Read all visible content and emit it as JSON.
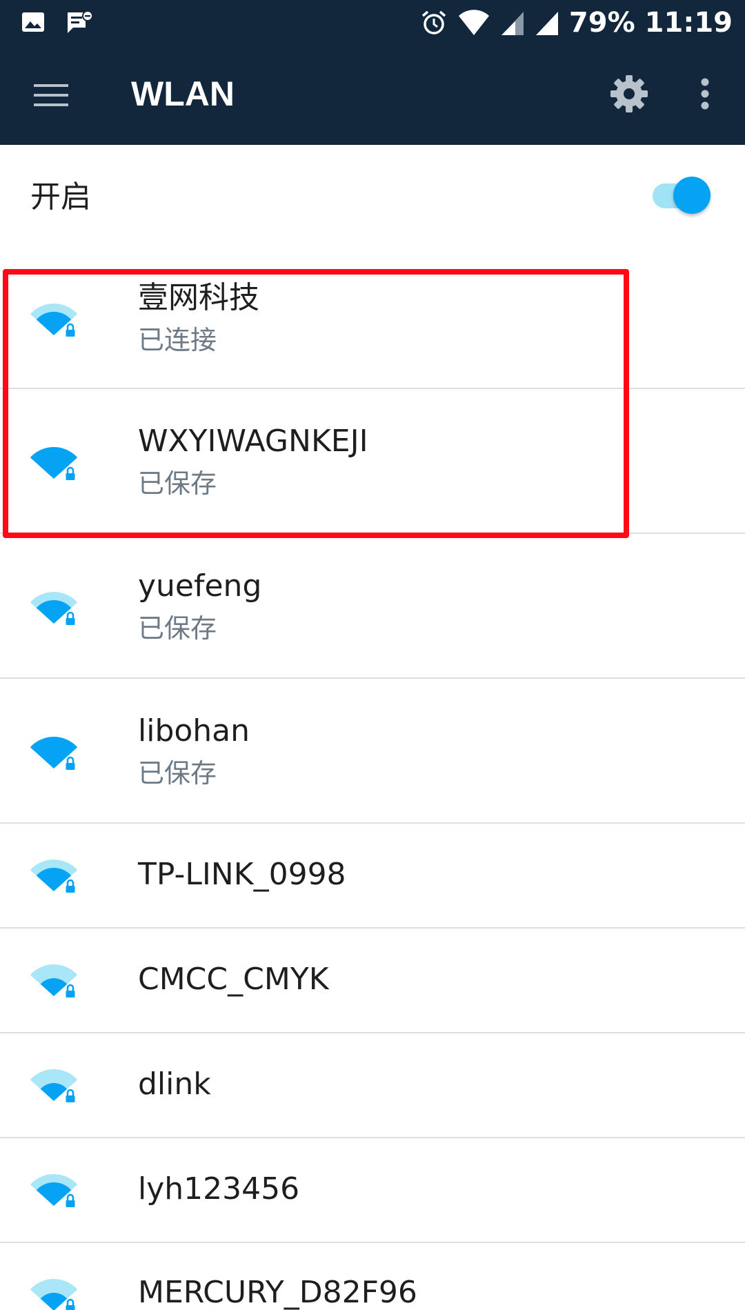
{
  "status_bar": {
    "left_icons": [
      "image-icon",
      "message-notification-icon"
    ],
    "right_icons": [
      "alarm-icon",
      "wifi-signal-icon",
      "cell-signal-icon",
      "cell-signal-icon"
    ],
    "battery": "79%",
    "time": "11:19"
  },
  "app_bar": {
    "title": "WLAN",
    "menu_icon": "hamburger-menu-icon",
    "settings_icon": "gear-icon",
    "overflow_icon": "more-vert-icon"
  },
  "wlan_toggle": {
    "label": "开启",
    "enabled": true
  },
  "networks": [
    {
      "name": "壹网科技",
      "status": "已连接",
      "signal": 3,
      "secured": true
    },
    {
      "name": "WXYIWAGNKEJI",
      "status": "已保存",
      "signal": 4,
      "secured": true
    },
    {
      "name": "yuefeng",
      "status": "已保存",
      "signal": 3,
      "secured": true
    },
    {
      "name": "libohan",
      "status": "已保存",
      "signal": 4,
      "secured": true
    },
    {
      "name": "TP-LINK_0998",
      "status": "",
      "signal": 3,
      "secured": true
    },
    {
      "name": "CMCC_CMYK",
      "status": "",
      "signal": 2,
      "secured": true
    },
    {
      "name": "dlink",
      "status": "",
      "signal": 2,
      "secured": true
    },
    {
      "name": "lyh123456",
      "status": "",
      "signal": 3,
      "secured": true
    },
    {
      "name": "MERCURY_D82F96",
      "status": "",
      "signal": 2,
      "secured": true
    }
  ],
  "colors": {
    "app_bar_background": "#12263c",
    "accent": "#06a3f5",
    "wifi_dim": "#a8e6f8",
    "annotation_red": "#ff0a16",
    "secondary_text": "#6d7a86",
    "divider": "#dcdfe3"
  }
}
